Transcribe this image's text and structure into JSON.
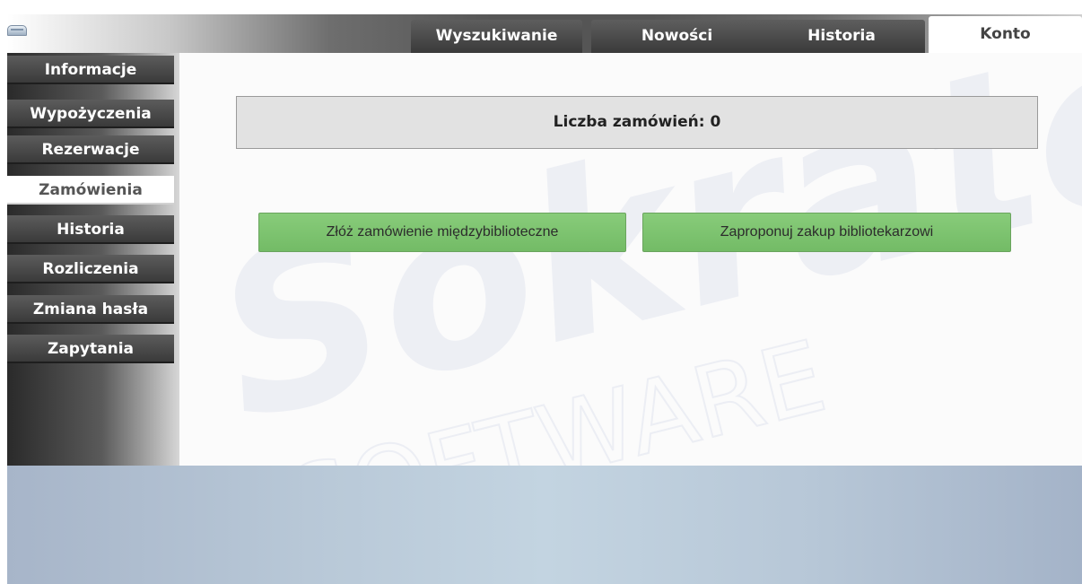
{
  "header": {
    "logo_icon": "drawer-icon",
    "tabs": [
      {
        "label": "Wyszukiwanie",
        "active": false
      },
      {
        "label": "Nowości",
        "active": false
      },
      {
        "label": "Historia",
        "active": false
      },
      {
        "label": "Konto",
        "active": true
      }
    ]
  },
  "sidebar": {
    "items": [
      {
        "label": "Informacje",
        "active": false
      },
      {
        "label": "Wypożyczenia",
        "active": false
      },
      {
        "label": "Rezerwacje",
        "active": false
      },
      {
        "label": "Zamówienia",
        "active": true
      },
      {
        "label": "Historia",
        "active": false
      },
      {
        "label": "Rozliczenia",
        "active": false
      },
      {
        "label": "Zmiana hasła",
        "active": false
      },
      {
        "label": "Zapytania",
        "active": false
      }
    ]
  },
  "main": {
    "count_text": "Liczba zamówień: 0",
    "buttons": {
      "interlibrary": "Złóż zamówienie międzybiblioteczne",
      "suggest_purchase": "Zaproponuj zakup bibliotekarzowi"
    },
    "watermark": {
      "brand": "Sokrates",
      "sub": "SOFTWARE"
    }
  },
  "colors": {
    "button_green": "#7ec270",
    "tab_dark": "#4a4a4a",
    "footer_blue": "#bacbda"
  }
}
